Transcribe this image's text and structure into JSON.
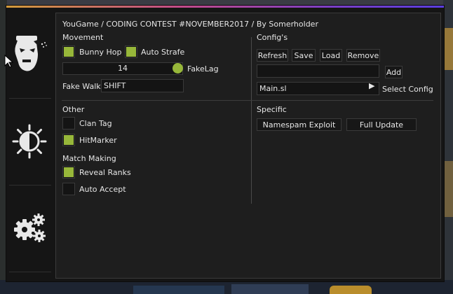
{
  "header": {
    "title": "YouGame / CODING CONTEST #NOVEMBER2017 / By Somerholder"
  },
  "sidebar": {
    "tabs": [
      {
        "name": "rage-icon",
        "active": true
      },
      {
        "name": "visuals-icon",
        "active": false
      },
      {
        "name": "settings-icon",
        "active": false
      }
    ]
  },
  "movement": {
    "section_label": "Movement",
    "bunny_hop": {
      "label": "Bunny Hop",
      "checked": true
    },
    "auto_strafe": {
      "label": "Auto Strafe",
      "checked": true
    },
    "fakelag": {
      "label": "FakeLag",
      "value": "14",
      "level": 1.0
    },
    "fake_walk": {
      "label": "Fake Walk",
      "key": "SHIFT"
    }
  },
  "configs": {
    "section_label": "Config's",
    "refresh_label": "Refresh",
    "save_label": "Save",
    "load_label": "Load",
    "remove_label": "Remove",
    "name_value": "",
    "add_label": "Add",
    "selected": "Main.sl",
    "select_label": "Select Config"
  },
  "other": {
    "section_label": "Other",
    "clan_tag": {
      "label": "Clan Tag",
      "checked": false
    },
    "hitmarker": {
      "label": "HitMarker",
      "checked": true
    }
  },
  "match_making": {
    "section_label": "Match Making",
    "reveal_ranks": {
      "label": "Reveal Ranks",
      "checked": true
    },
    "auto_accept": {
      "label": "Auto Accept",
      "checked": false
    }
  },
  "specific": {
    "section_label": "Specific",
    "namespam_label": "Namespam Exploit",
    "full_update_label": "Full Update"
  },
  "colors": {
    "accent": "#97b73a",
    "window_bg": "#151515",
    "panel_bg": "#1e1e1e"
  }
}
